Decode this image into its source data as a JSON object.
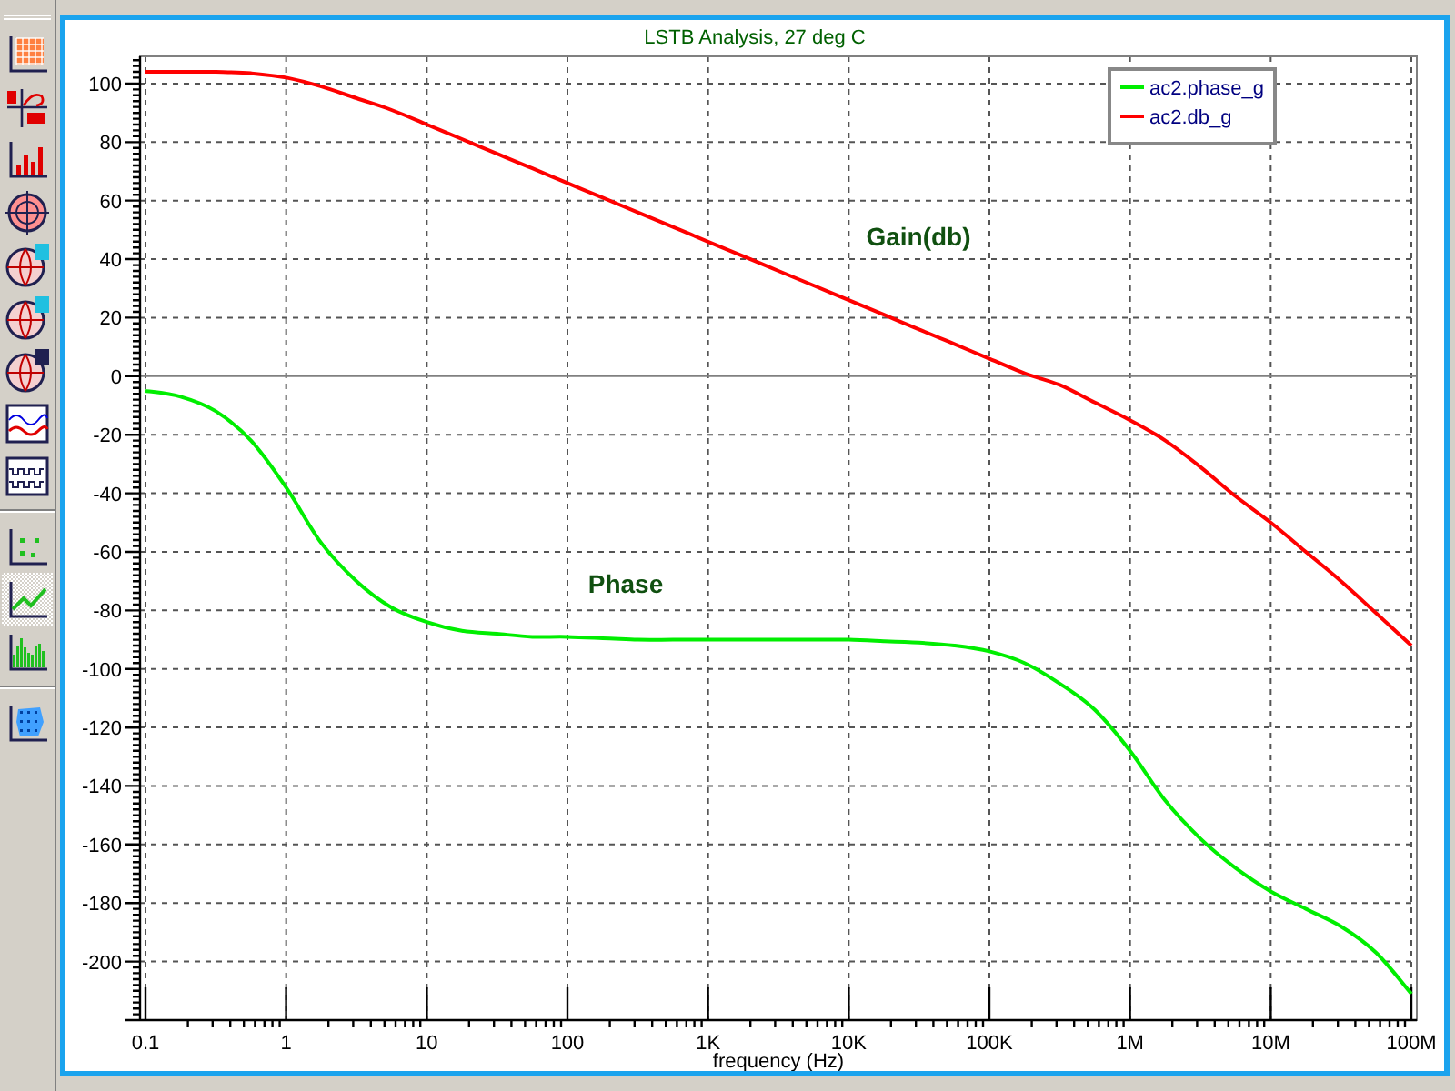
{
  "toolbar": [
    [
      {
        "kind": "grid",
        "selected": false
      },
      {
        "kind": "complex",
        "selected": false
      },
      {
        "kind": "bars",
        "selected": false
      },
      {
        "kind": "polar",
        "selected": false
      },
      {
        "kind": "smith-z",
        "selected": false
      },
      {
        "kind": "smith-y",
        "selected": false
      },
      {
        "kind": "smith-e",
        "selected": false
      },
      {
        "kind": "waves",
        "selected": false
      },
      {
        "kind": "square",
        "selected": false
      }
    ],
    [
      {
        "kind": "scatter",
        "selected": false
      },
      {
        "kind": "line",
        "selected": true
      },
      {
        "kind": "histogram",
        "selected": false
      }
    ],
    [
      {
        "kind": "density",
        "selected": false
      }
    ]
  ],
  "plot": {
    "chart_data": {
      "type": "line",
      "title": "LSTB Analysis, 27 deg C",
      "xlabel": "frequency (Hz)",
      "categories": [
        "0.1",
        null,
        null,
        null,
        "1",
        null,
        null,
        null,
        "10",
        null,
        null,
        null,
        "100",
        null,
        null,
        null,
        "1K",
        null,
        null,
        null,
        "10K",
        null,
        null,
        null,
        "100K",
        null,
        null,
        null,
        "1M",
        null,
        null,
        null,
        "10M",
        null,
        null,
        null,
        "100M"
      ],
      "series": [
        {
          "name": "ac2.phase_g",
          "color": "#00ee00",
          "values": [
            -5,
            -7,
            -12,
            -22,
            -38,
            -57,
            -70,
            -79,
            -84,
            -87,
            -88,
            -89,
            -89,
            -89.5,
            -90,
            -90,
            -90,
            -90,
            -90,
            -90,
            -90,
            -90.5,
            -91,
            -92,
            -94,
            -98,
            -105,
            -114,
            -128,
            -145,
            -158,
            -168,
            -176,
            -182,
            -188,
            -197,
            -211
          ]
        },
        {
          "name": "ac2.db_g",
          "color": "#ff0000",
          "values": [
            104,
            104,
            104,
            103.5,
            102,
            99,
            95,
            91,
            86,
            81,
            76,
            71,
            66,
            61,
            56,
            51,
            46,
            41,
            36,
            31,
            26,
            21,
            16,
            11,
            6,
            1,
            -3,
            -9,
            -15,
            -22,
            -31,
            -41,
            -50,
            -60,
            -70,
            -81,
            -92
          ]
        }
      ],
      "ylim": [
        -220,
        109.3
      ],
      "grid": true,
      "legend": true,
      "yticks": [
        100,
        80,
        60,
        40,
        20,
        0,
        -20,
        -40,
        -60,
        -80,
        -100,
        -120,
        -140,
        -160,
        -180,
        -200
      ],
      "annotations": [
        "Gain(db)",
        "Phase"
      ]
    }
  }
}
